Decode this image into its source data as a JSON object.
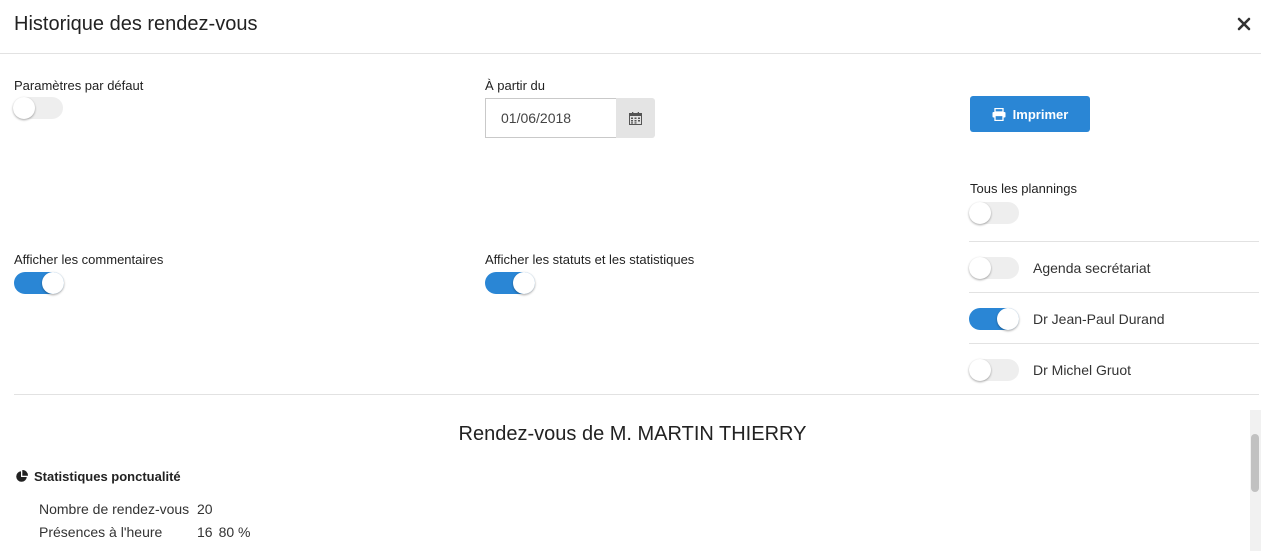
{
  "dialog": {
    "title": "Historique des rendez-vous",
    "close_icon": "close-icon"
  },
  "settings": {
    "default_params": {
      "label": "Paramètres par défaut",
      "on": false
    },
    "from_date": {
      "label": "À partir du",
      "value": "01/06/2018"
    },
    "print_label": "Imprimer",
    "show_comments": {
      "label": "Afficher les commentaires",
      "on": true
    },
    "show_statuses": {
      "label": "Afficher les statuts et les statistiques",
      "on": true
    },
    "all_plannings": {
      "label": "Tous les plannings",
      "on": false
    },
    "plannings": [
      {
        "label": "Agenda secrétariat",
        "on": false
      },
      {
        "label": "Dr Jean-Paul Durand",
        "on": true
      },
      {
        "label": "Dr Michel Gruot",
        "on": false
      }
    ]
  },
  "report": {
    "title": "Rendez-vous de M. MARTIN THIERRY",
    "stats_heading": "Statistiques ponctualité",
    "stats": [
      {
        "label": "Nombre de rendez-vous",
        "value": "20",
        "percent": ""
      },
      {
        "label": "Présences à l'heure",
        "value": "16",
        "percent": "80 %"
      }
    ]
  },
  "colors": {
    "accent": "#2a86d5",
    "toggle_off": "#eeeeee"
  }
}
